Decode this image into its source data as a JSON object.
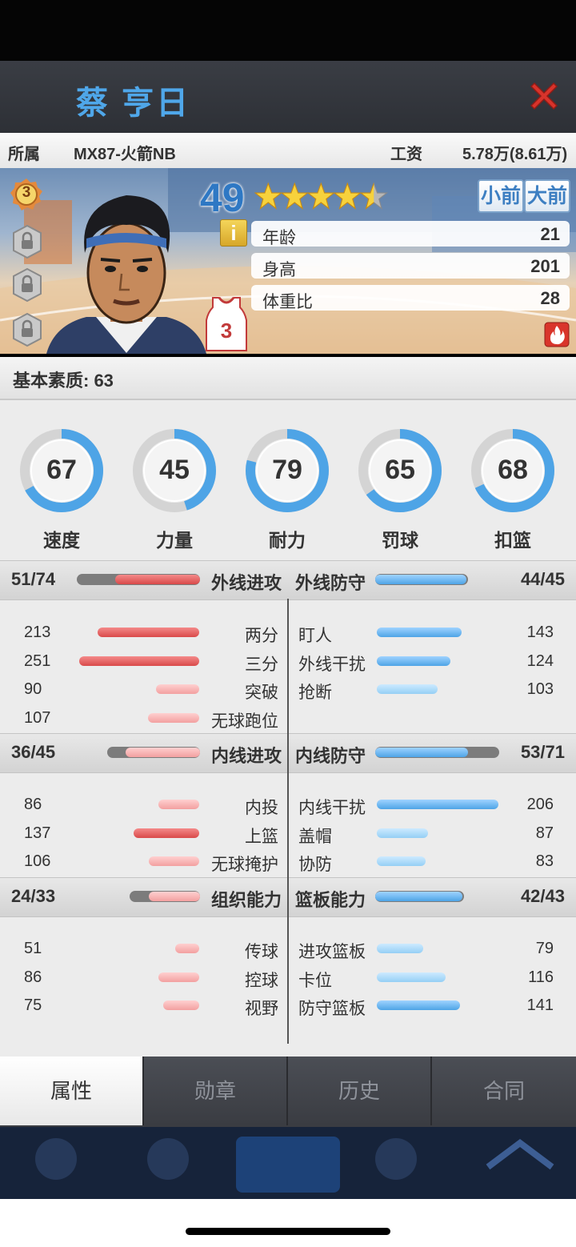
{
  "player": {
    "name": "蔡 亨日",
    "team_label": "所属",
    "team": "MX87-火箭NB",
    "salary_label": "工资",
    "salary": "5.78万(8.61万)",
    "rating": "49",
    "jersey_number": "3",
    "level_badge": "3",
    "positions": [
      "小前",
      "大前"
    ],
    "info_icon": "i",
    "stars": 4.5
  },
  "bio": [
    {
      "label": "年龄",
      "value": "21"
    },
    {
      "label": "身高",
      "value": "201"
    },
    {
      "label": "体重比",
      "value": "28"
    }
  ],
  "base_quality": "基本素质: 63",
  "rings": [
    {
      "label": "速度",
      "value": "67",
      "percent": 67
    },
    {
      "label": "力量",
      "value": "45",
      "percent": 45
    },
    {
      "label": "耐力",
      "value": "79",
      "percent": 79
    },
    {
      "label": "罚球",
      "value": "65",
      "percent": 65
    },
    {
      "label": "扣篮",
      "value": "68",
      "percent": 68
    }
  ],
  "sections": [
    {
      "left_score": "51/74",
      "left_title": "外线进攻",
      "left_ratio": 0.69,
      "right_title": "外线防守",
      "right_score": "44/45",
      "right_ratio": 0.98,
      "left_rows": [
        {
          "label": "两分",
          "value": "213"
        },
        {
          "label": "三分",
          "value": "251"
        },
        {
          "label": "突破",
          "value": "90"
        },
        {
          "label": "无球跑位",
          "value": "107"
        }
      ],
      "right_rows": [
        {
          "label": "盯人",
          "value": "143"
        },
        {
          "label": "外线干扰",
          "value": "124"
        },
        {
          "label": "抢断",
          "value": "103"
        }
      ]
    },
    {
      "left_score": "36/45",
      "left_title": "内线进攻",
      "left_ratio": 0.8,
      "right_title": "内线防守",
      "right_score": "53/71",
      "right_ratio": 0.75,
      "left_rows": [
        {
          "label": "内投",
          "value": "86"
        },
        {
          "label": "上篮",
          "value": "137"
        },
        {
          "label": "无球掩护",
          "value": "106"
        }
      ],
      "right_rows": [
        {
          "label": "内线干扰",
          "value": "206"
        },
        {
          "label": "盖帽",
          "value": "87"
        },
        {
          "label": "协防",
          "value": "83"
        }
      ]
    },
    {
      "left_score": "24/33",
      "left_title": "组织能力",
      "left_ratio": 0.73,
      "right_title": "篮板能力",
      "right_score": "42/43",
      "right_ratio": 0.98,
      "left_rows": [
        {
          "label": "传球",
          "value": "51"
        },
        {
          "label": "控球",
          "value": "86"
        },
        {
          "label": "视野",
          "value": "75"
        }
      ],
      "right_rows": [
        {
          "label": "进攻篮板",
          "value": "79"
        },
        {
          "label": "卡位",
          "value": "116"
        },
        {
          "label": "防守篮板",
          "value": "141"
        }
      ]
    }
  ],
  "tabs": [
    "属性",
    "勋章",
    "历史",
    "合同"
  ],
  "active_tab": "属性",
  "colors": {
    "accent_blue": "#4fa7ea",
    "attack_red": "#d94a4a",
    "defense_blue": "#4ea4e6",
    "close_red": "#d8332b"
  }
}
